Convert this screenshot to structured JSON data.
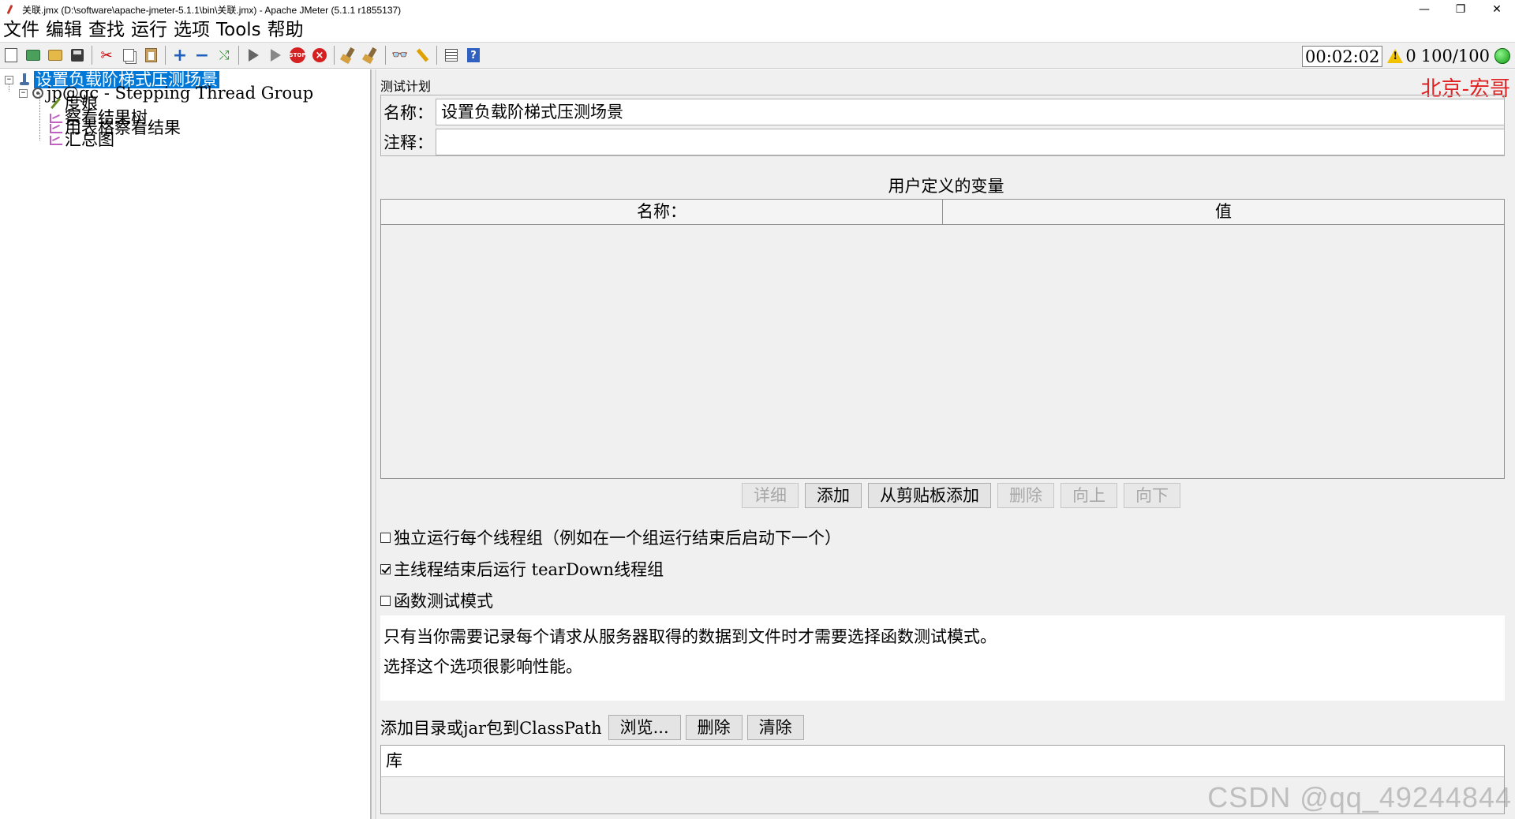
{
  "window": {
    "title": "关联.jmx (D:\\software\\apache-jmeter-5.1.1\\bin\\关联.jmx) - Apache JMeter (5.1.1 r1855137)",
    "minimize": "—",
    "restore": "❐",
    "close": "✕"
  },
  "menu": {
    "items": [
      "文件",
      "编辑",
      "查找",
      "运行",
      "选项",
      "Tools",
      "帮助"
    ]
  },
  "toolbar": {
    "timer": "00:02:02",
    "warnings": "0",
    "threads": "100/100"
  },
  "tree": {
    "root": "设置负载阶梯式压测场景",
    "group": "jp@gc - Stepping Thread Group",
    "children": [
      "度娘",
      "察看结果树",
      "用表格察看结果",
      "汇总图"
    ]
  },
  "panel": {
    "title": "测试计划",
    "brand": "北京-宏哥",
    "name_label": "名称：",
    "name_value": "设置负载阶梯式压测场景",
    "comment_label": "注释：",
    "comment_value": "",
    "vars_caption": "用户定义的变量",
    "vars_columns": [
      "名称：",
      "值"
    ],
    "buttons": {
      "detail": "详细",
      "add": "添加",
      "add_clipboard": "从剪贴板添加",
      "delete": "删除",
      "up": "向上",
      "down": "向下"
    },
    "options": {
      "serialize": "独立运行每个线程组（例如在一个组运行结束后启动下一个）",
      "teardown": "主线程结束后运行 tearDown线程组",
      "functional": "函数测试模式"
    },
    "help_lines": [
      "只有当你需要记录每个请求从服务器取得的数据到文件时才需要选择函数测试模式。",
      "选择这个选项很影响性能。"
    ],
    "classpath": {
      "label": "添加目录或jar包到ClassPath",
      "browse": "浏览...",
      "delete": "删除",
      "clear": "清除",
      "lib_header": "库"
    }
  },
  "watermark": "CSDN @qq_49244844"
}
